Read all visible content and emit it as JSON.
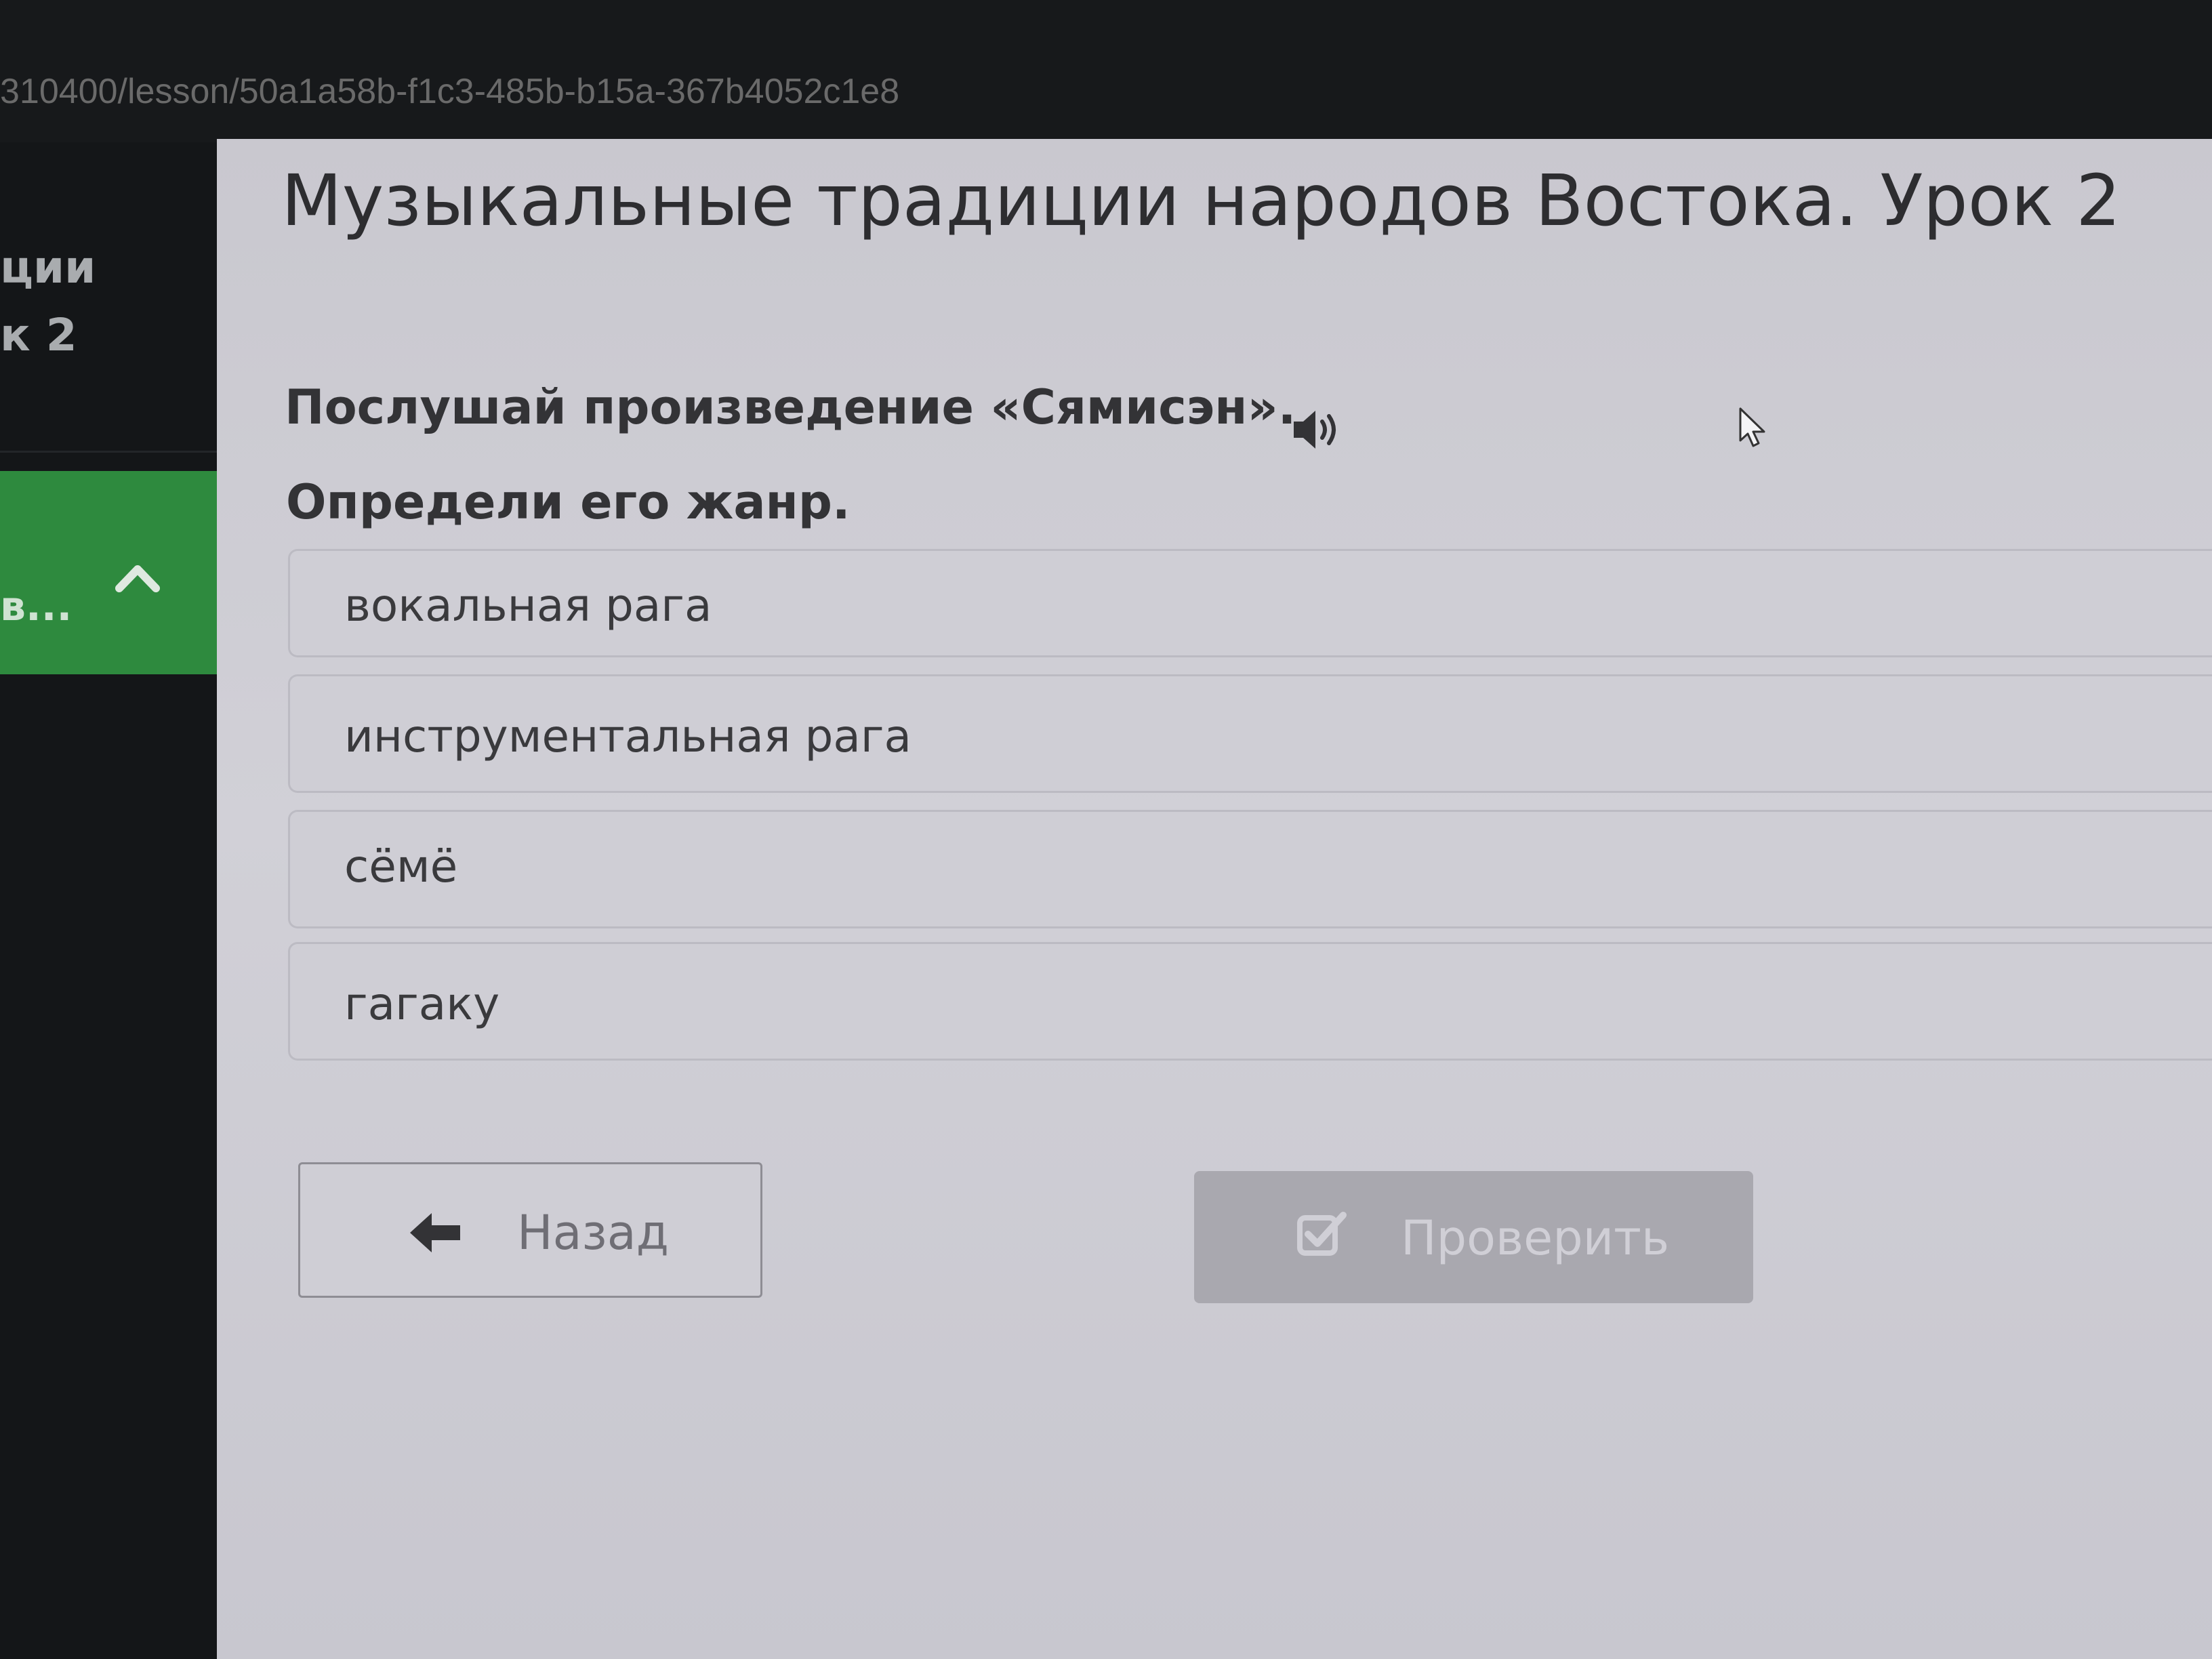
{
  "browser": {
    "url": "310400/lesson/50a1a58b-f1c3-485b-b15a-367b4052c1e8"
  },
  "sidebar": {
    "title_fragment": "ции\nк 2",
    "active_item_label": "в..."
  },
  "lesson": {
    "title": "Музыкальные традиции народов Востока. Урок 2"
  },
  "question": {
    "line1": "Послушай произведение «Сямисэн».",
    "line2": "Определи его жанр."
  },
  "options": [
    {
      "label": "вокальная рага"
    },
    {
      "label": "инструментальная рага"
    },
    {
      "label": "сёмё"
    },
    {
      "label": "гагаку"
    }
  ],
  "buttons": {
    "back_label": "Назад",
    "check_label": "Проверить"
  },
  "colors": {
    "sidebar_active": "#2e8a3e",
    "content_bg": "#cfced5",
    "check_button_disabled": "#a9a8af"
  },
  "icons": {
    "speaker": "speaker-icon",
    "back": "arrow-left-icon",
    "check": "checkbox-check-icon",
    "chevron": "chevron-up-icon"
  }
}
